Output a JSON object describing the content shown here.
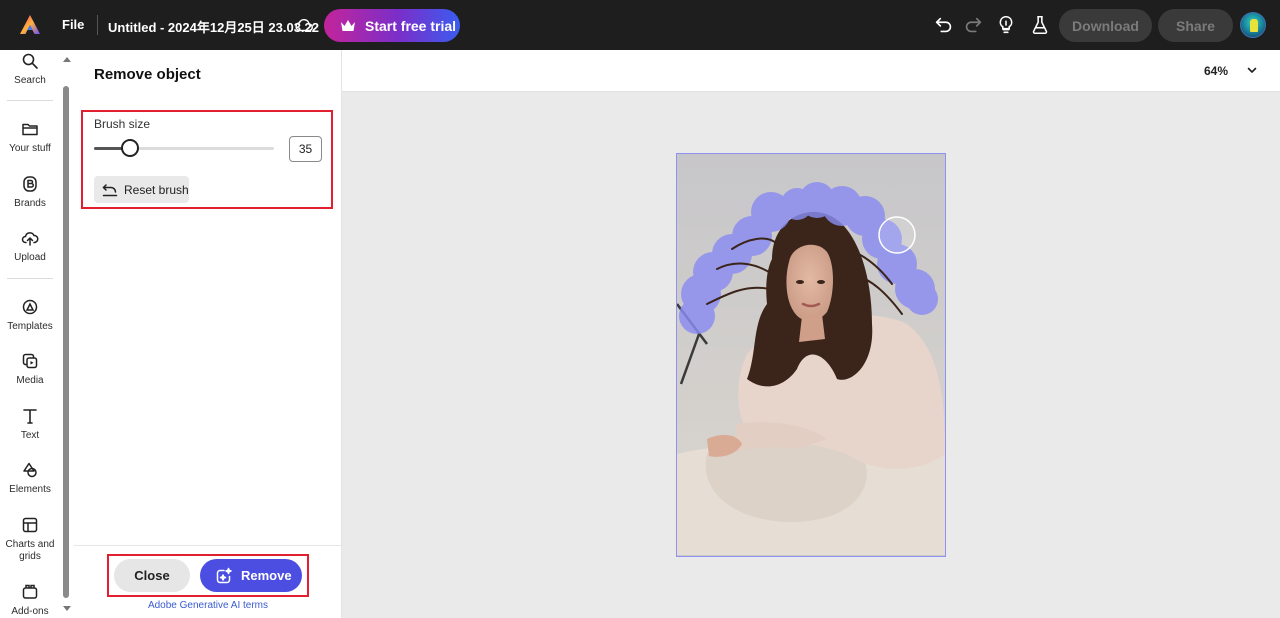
{
  "topbar": {
    "file_label": "File",
    "doc_title": "Untitled - 2024年12月25日 23.03.22",
    "trial_label": "Start free trial",
    "download_label": "Download",
    "share_label": "Share"
  },
  "rail": {
    "items": [
      {
        "label": "Search",
        "icon": "search-icon"
      },
      {
        "label": "Your stuff",
        "icon": "folder-icon"
      },
      {
        "label": "Brands",
        "icon": "brand-icon"
      },
      {
        "label": "Upload",
        "icon": "upload-icon"
      },
      {
        "label": "Templates",
        "icon": "templates-icon"
      },
      {
        "label": "Media",
        "icon": "media-icon"
      },
      {
        "label": "Text",
        "icon": "text-icon"
      },
      {
        "label": "Elements",
        "icon": "elements-icon"
      },
      {
        "label": "Charts and grids",
        "icon": "charts-icon"
      },
      {
        "label": "Add-ons",
        "icon": "addons-icon"
      }
    ]
  },
  "panel": {
    "title": "Remove object",
    "brush_label": "Brush size",
    "brush_value": "35",
    "brush_fraction": 0.2,
    "reset_label": "Reset brush",
    "close_label": "Close",
    "remove_label": "Remove",
    "terms_label": "Adobe Generative AI terms"
  },
  "canvas": {
    "zoom": "64%"
  },
  "colors": {
    "accent": "#4b4ee0",
    "highlight_box": "#e0202e",
    "topbar": "#1e1e1e",
    "mask": "#8a8cf2"
  }
}
